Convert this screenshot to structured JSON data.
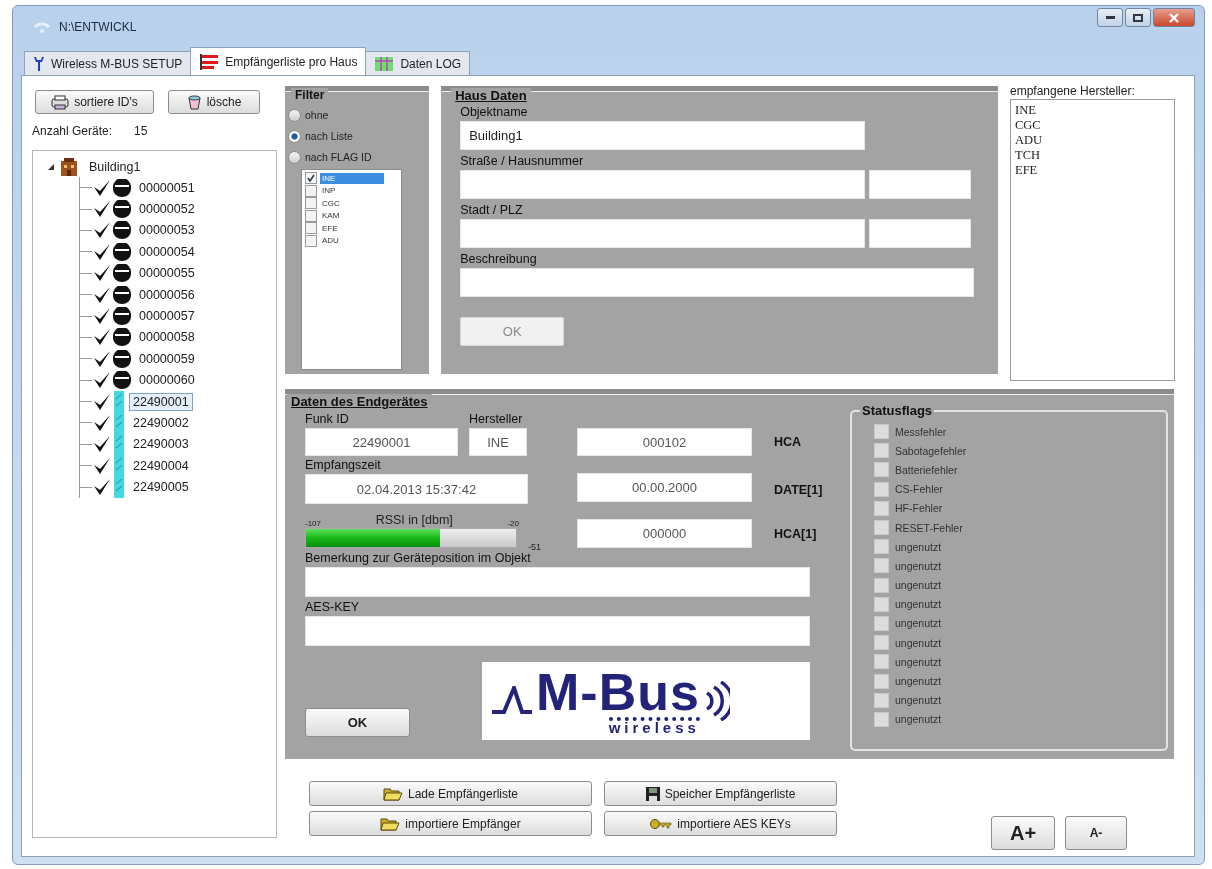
{
  "window": {
    "title": "N:\\ENTWICKL"
  },
  "tabs": [
    {
      "label": "Wireless M-BUS SETUP",
      "selected": false
    },
    {
      "label": "Empfängerliste pro Haus",
      "selected": true
    },
    {
      "label": "Daten LOG",
      "selected": false
    }
  ],
  "device_list": {
    "sort_button": "sortiere ID's",
    "delete_button": "lösche",
    "count_label": "Anzahl Geräte:",
    "count": "15",
    "tree": {
      "label": "Building1",
      "expanded": true,
      "children": [
        {
          "label": "00000051",
          "kind": "meter",
          "selected": false
        },
        {
          "label": "00000052",
          "kind": "meter",
          "selected": false
        },
        {
          "label": "00000053",
          "kind": "meter",
          "selected": false
        },
        {
          "label": "00000054",
          "kind": "meter",
          "selected": false
        },
        {
          "label": "00000055",
          "kind": "meter",
          "selected": false
        },
        {
          "label": "00000056",
          "kind": "meter",
          "selected": false
        },
        {
          "label": "00000057",
          "kind": "meter",
          "selected": false
        },
        {
          "label": "00000058",
          "kind": "meter",
          "selected": false
        },
        {
          "label": "00000059",
          "kind": "meter",
          "selected": false
        },
        {
          "label": "00000060",
          "kind": "meter",
          "selected": false
        },
        {
          "label": "22490001",
          "kind": "sensor",
          "selected": true
        },
        {
          "label": "22490002",
          "kind": "sensor",
          "selected": false
        },
        {
          "label": "22490003",
          "kind": "sensor",
          "selected": false
        },
        {
          "label": "22490004",
          "kind": "sensor",
          "selected": false
        },
        {
          "label": "22490005",
          "kind": "sensor",
          "selected": false
        }
      ]
    }
  },
  "filter": {
    "title": "Filter",
    "options": [
      {
        "label": "ohne",
        "selected": false
      },
      {
        "label": "nach Liste",
        "selected": true
      },
      {
        "label": "nach FLAG ID",
        "selected": false
      }
    ],
    "flags": [
      {
        "label": "INE",
        "checked": true,
        "selected": true
      },
      {
        "label": "INP",
        "checked": false,
        "selected": false
      },
      {
        "label": "CGC",
        "checked": false,
        "selected": false
      },
      {
        "label": "KAM",
        "checked": false,
        "selected": false
      },
      {
        "label": "EFE",
        "checked": false,
        "selected": false
      },
      {
        "label": "ADU",
        "checked": false,
        "selected": false
      }
    ]
  },
  "haus_daten": {
    "title": "Haus Daten",
    "fields": [
      {
        "label": "Objektname",
        "kind": "single",
        "value": "Building1"
      },
      {
        "label": "Straße / Hausnummer",
        "kind": "pair"
      },
      {
        "label": "Stadt / PLZ",
        "kind": "pair"
      },
      {
        "label": "Beschreibung",
        "kind": "wide"
      }
    ],
    "ok_button": {
      "label": "OK",
      "disabled": true
    }
  },
  "hersteller": {
    "title": "empfangene Hersteller:",
    "items": [
      "INE",
      "CGC",
      "ADU",
      "TCH",
      "EFE"
    ]
  },
  "endgeraet": {
    "title": "Daten des Endgerätes",
    "funk_id": {
      "label": "Funk ID",
      "value": "22490001"
    },
    "hersteller": {
      "label": "Hersteller",
      "value": "INE"
    },
    "empfangszeit": {
      "label": "Empfangszeit",
      "value": "02.04.2013 15:37:42"
    },
    "rssi": {
      "label": "RSSI in [dbm]",
      "min": "-107",
      "max": "-20",
      "level": 0.64,
      "reading": "-51"
    },
    "values": [
      {
        "value": "000102",
        "label": "HCA"
      },
      {
        "value": "00.00.2000",
        "label": "DATE[1]"
      },
      {
        "value": "000000",
        "label": "HCA[1]"
      }
    ],
    "bemerkung": {
      "label": "Bemerkung zur Geräteposition im Objekt"
    },
    "aes_key": {
      "label": "AES-KEY"
    },
    "ok_button": {
      "label": "OK"
    },
    "logo": {
      "title": "M-Bus",
      "subtitle": "wireless"
    },
    "statusflags": {
      "title": "Statusflags",
      "flags": [
        {
          "label": "Messfehler",
          "checked": false,
          "disabled": true
        },
        {
          "label": "Sabotagefehler",
          "checked": false,
          "disabled": true
        },
        {
          "label": "Batteriefehler",
          "checked": false,
          "disabled": true
        },
        {
          "label": "CS-Fehler",
          "checked": false,
          "disabled": true
        },
        {
          "label": "HF-Fehler",
          "checked": false,
          "disabled": true
        },
        {
          "label": "RESET-Fehler",
          "checked": false,
          "disabled": true
        },
        {
          "label": "ungenutzt",
          "checked": false,
          "disabled": true
        },
        {
          "label": "ungenutzt",
          "checked": false,
          "disabled": true
        },
        {
          "label": "ungenutzt",
          "checked": false,
          "disabled": true
        },
        {
          "label": "ungenutzt",
          "checked": false,
          "disabled": true
        },
        {
          "label": "ungenutzt",
          "checked": false,
          "disabled": true
        },
        {
          "label": "ungenutzt",
          "checked": false,
          "disabled": true
        },
        {
          "label": "ungenutzt",
          "checked": false,
          "disabled": true
        },
        {
          "label": "ungenutzt",
          "checked": false,
          "disabled": true
        },
        {
          "label": "ungenutzt",
          "checked": false,
          "disabled": true
        },
        {
          "label": "ungenutzt",
          "checked": false,
          "disabled": true
        }
      ]
    }
  },
  "actions": [
    {
      "label": "Lade Empfängerliste"
    },
    {
      "label": "Speicher Empfängerliste"
    },
    {
      "label": "importiere Empfänger"
    },
    {
      "label": "importiere AES KEYs"
    }
  ],
  "font_buttons": [
    "A+",
    "A-"
  ]
}
